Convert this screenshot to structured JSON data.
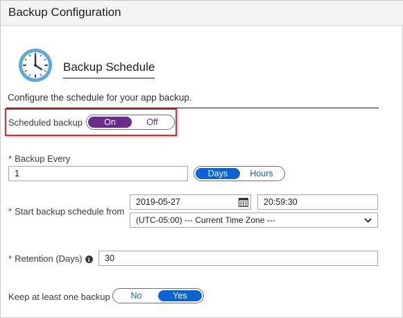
{
  "window": {
    "title": "Backup Configuration"
  },
  "section": {
    "title": "Backup Schedule",
    "icon": "clock-icon",
    "description": "Configure the schedule for your app backup."
  },
  "scheduled_backup": {
    "label": "Scheduled backup",
    "on_label": "On",
    "off_label": "Off",
    "selected": "On"
  },
  "backup_every": {
    "label": "Backup Every",
    "required_mark": "*",
    "value": "1",
    "days_label": "Days",
    "hours_label": "Hours",
    "selected": "Days"
  },
  "start_schedule": {
    "label": "Start backup schedule from",
    "required_mark": "*",
    "date": "2019-05-27",
    "time": "20:59:30",
    "timezone": "(UTC-05:00) --- Current Time Zone ---"
  },
  "retention": {
    "label": "Retention (Days)",
    "required_mark": "*",
    "info_icon": "i",
    "value": "30"
  },
  "keep_one": {
    "label": "Keep at least one backup",
    "no_label": "No",
    "yes_label": "Yes",
    "selected": "Yes"
  },
  "colors": {
    "toggle_purple": "#6b2b8a",
    "toggle_blue": "#0a64d6",
    "highlight_red": "#d9302f",
    "required_red": "#a4262c"
  }
}
